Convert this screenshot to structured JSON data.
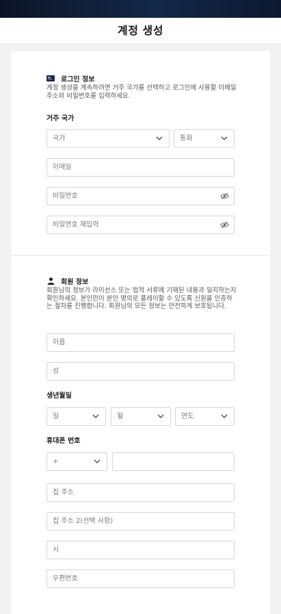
{
  "page": {
    "title": "계정 생성"
  },
  "login_section": {
    "title": "로그인 정보",
    "icon": "id-card-icon",
    "description": "계정 생성을 계속하려면 거주 국가를 선택하고 로그인에 사용할 이메일 주소와 비밀번호를 입력하세요.",
    "country_label": "거주 국가",
    "country_placeholder": "국가",
    "currency_placeholder": "통화",
    "email_placeholder": "이메일",
    "password_placeholder": "비밀번호",
    "password_confirm_placeholder": "비밀번호 재입력"
  },
  "member_section": {
    "title": "회원 정보",
    "icon": "person-icon",
    "description": "회원님의 정보가 라이선스 또는 법적 서류에 기재된 내용과 일치하는지 확인하세요. 본인만이 본인 명의로 플레이할 수 있도록 신원을 인증하는 절차를 진행합니다. 회원님의 모든 정보는 안전하게 보호됩니다.",
    "first_name_placeholder": "이름",
    "last_name_placeholder": "성",
    "birth_label": "생년월일",
    "day_placeholder": "일",
    "month_placeholder": "월",
    "year_placeholder": "연도",
    "phone_label": "휴대폰 번호",
    "phone_code_placeholder": "+",
    "phone_number_value": "",
    "address_placeholder": "집 주소",
    "address2_placeholder": "집 주소 2(선택 사항)",
    "city_placeholder": "시",
    "zip_placeholder": "우편번호"
  },
  "colors": {
    "topbar": "#0b1426",
    "border": "#d6d6d6",
    "background": "#f2f2f2"
  }
}
